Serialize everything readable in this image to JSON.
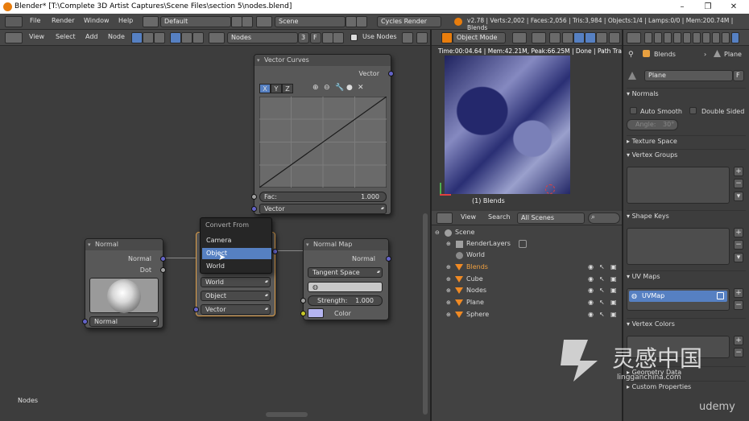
{
  "window": {
    "title": "Blender* [T:\\Complete 3D Artist Captures\\Scene Files\\section 5\\nodes.blend]",
    "controls": [
      "–",
      "❐",
      "✕"
    ]
  },
  "info": {
    "menus": [
      "File",
      "Render",
      "Window",
      "Help"
    ],
    "layout": "Default",
    "scene": "Scene",
    "engine": "Cycles Render",
    "stats": "v2.78 | Verts:2,002 | Faces:2,056 | Tris:3,984 | Objects:1/4 | Lamps:0/0 | Mem:200.74M | Blends"
  },
  "node_editor": {
    "menus": [
      "View",
      "Select",
      "Add",
      "Node"
    ],
    "tree_name": "Nodes",
    "users": "3",
    "fake_user": "F",
    "use_nodes_label": "Use Nodes",
    "footer_label": "Nodes",
    "nodes": {
      "vector_curves": {
        "title": "Vector Curves",
        "output": "Vector",
        "axes": [
          "X",
          "Y",
          "Z"
        ],
        "fac_label": "Fac:",
        "fac_value": "1.000",
        "input": "Vector"
      },
      "normal": {
        "title": "Normal",
        "outputs": [
          "Normal",
          "Dot"
        ],
        "input": "Normal"
      },
      "vector_transform": {
        "fields": [
          "World",
          "Object",
          "Vector"
        ]
      },
      "normal_map": {
        "title": "Normal Map",
        "output": "Normal",
        "space": "Tangent Space",
        "strength_label": "Strength:",
        "strength_value": "1.000",
        "color_label": "Color"
      }
    },
    "dropdown": {
      "title": "Convert From",
      "items": [
        "Camera",
        "Object",
        "World"
      ],
      "selected": "Object"
    }
  },
  "viewport": {
    "mode": "Object Mode",
    "render_stats": "Time:00:04.64 | Mem:42.21M, Peak:66.25M | Done | Path Tra",
    "caption": "(1) Blends"
  },
  "outliner": {
    "menus": [
      "View",
      "Search"
    ],
    "filter": "All Scenes",
    "rows": [
      {
        "label": "Scene",
        "indent": 0
      },
      {
        "label": "RenderLayers",
        "indent": 1
      },
      {
        "label": "World",
        "indent": 1
      },
      {
        "label": "Blends",
        "indent": 1
      },
      {
        "label": "Cube",
        "indent": 1
      },
      {
        "label": "Nodes",
        "indent": 1
      },
      {
        "label": "Plane",
        "indent": 1
      },
      {
        "label": "Sphere",
        "indent": 1
      }
    ]
  },
  "properties": {
    "breadcrumb": [
      "Blends",
      "Plane"
    ],
    "mesh_name": "Plane",
    "mesh_fake": "F",
    "normals": {
      "header": "Normals",
      "auto_smooth": "Auto Smooth",
      "double_sided": "Double Sided",
      "angle_label": "Angle:",
      "angle_value": "30°"
    },
    "panels": [
      "Texture Space",
      "Vertex Groups",
      "Shape Keys",
      "UV Maps",
      "Vertex Colors",
      "Geometry Data",
      "Custom Properties"
    ],
    "uv_map": "UVMap"
  },
  "watermark": {
    "cn": "灵感中国",
    "url": "lingganchina.com",
    "brand": "udemy"
  }
}
